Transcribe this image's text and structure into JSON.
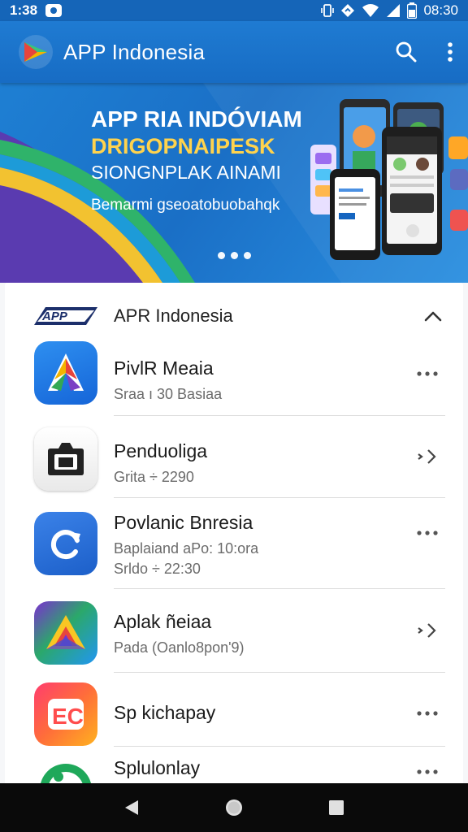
{
  "status_bar": {
    "time": "1:38",
    "clock": "08:30"
  },
  "app_bar": {
    "title": "APP Indonesia",
    "icons": [
      "app-logo-icon",
      "search-icon",
      "more-vert-icon"
    ]
  },
  "banner": {
    "headline": "APP RIA INDÓVIAM",
    "subhead": "DRIGOPNAIPESK",
    "subhead2": "SIONGNPLAK AINAMI",
    "tagline": "Bemarmi gseoatobuobahqk",
    "carousel_dots": 3
  },
  "section": {
    "logo_text": "APP",
    "title": "APR Indonesia"
  },
  "apps": [
    {
      "name": "PivlR Meaia",
      "subtitle": "Sraa ı 30 Basiaa",
      "subtitle2": "",
      "action": "more",
      "icon": "a-logo-icon"
    },
    {
      "name": "Penduoliga",
      "subtitle": "Grita ÷ 2290",
      "subtitle2": "",
      "action": "chevron",
      "icon": "camera-icon"
    },
    {
      "name": "Povlanic Bnresia",
      "subtitle": "Baplaiand aPo: 10:ora",
      "subtitle2": "Srldo ÷ 22:30",
      "action": "more",
      "icon": "refresh-icon"
    },
    {
      "name": "Aplak ñeiaa",
      "subtitle": "Pada (Oanlo8pon'9)",
      "subtitle2": "",
      "action": "chevron",
      "icon": "triangle-logo-icon"
    },
    {
      "name": "Sp kichapay",
      "subtitle": "",
      "subtitle2": "",
      "action": "more",
      "icon": "ec-logo-icon"
    },
    {
      "name": "Splulonlay",
      "subtitle": "",
      "subtitle2": "",
      "action": "more",
      "icon": "green-circle-icon"
    }
  ],
  "colors": {
    "app_bar": "#1f7bd2",
    "status_bar": "#1565b8",
    "banner_yellow": "#ffd34d"
  }
}
